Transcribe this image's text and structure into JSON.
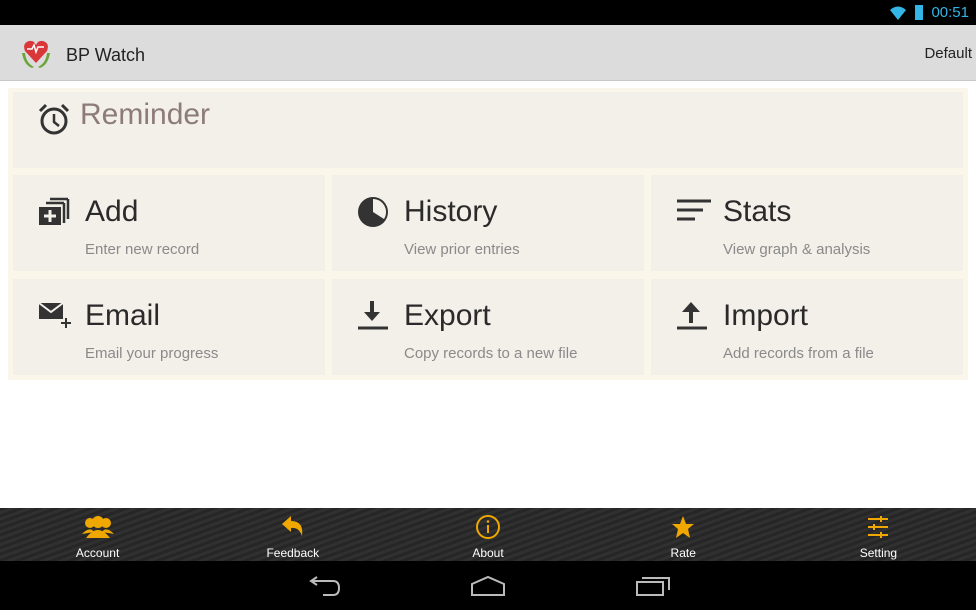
{
  "status": {
    "time": "00:51"
  },
  "app": {
    "title": "BP Watch",
    "profile": "Default"
  },
  "reminder": {
    "title": "Reminder"
  },
  "tiles": [
    {
      "title": "Add",
      "subtitle": "Enter new record"
    },
    {
      "title": "History",
      "subtitle": "View prior entries"
    },
    {
      "title": "Stats",
      "subtitle": "View graph & analysis"
    },
    {
      "title": "Email",
      "subtitle": "Email your progress"
    },
    {
      "title": "Export",
      "subtitle": "Copy records to a new file"
    },
    {
      "title": "Import",
      "subtitle": "Add records from a file"
    }
  ],
  "bottom": [
    "Account",
    "Feedback",
    "About",
    "Rate",
    "Setting"
  ],
  "colors": {
    "accent": "#f0a800",
    "status": "#33b5e5"
  }
}
